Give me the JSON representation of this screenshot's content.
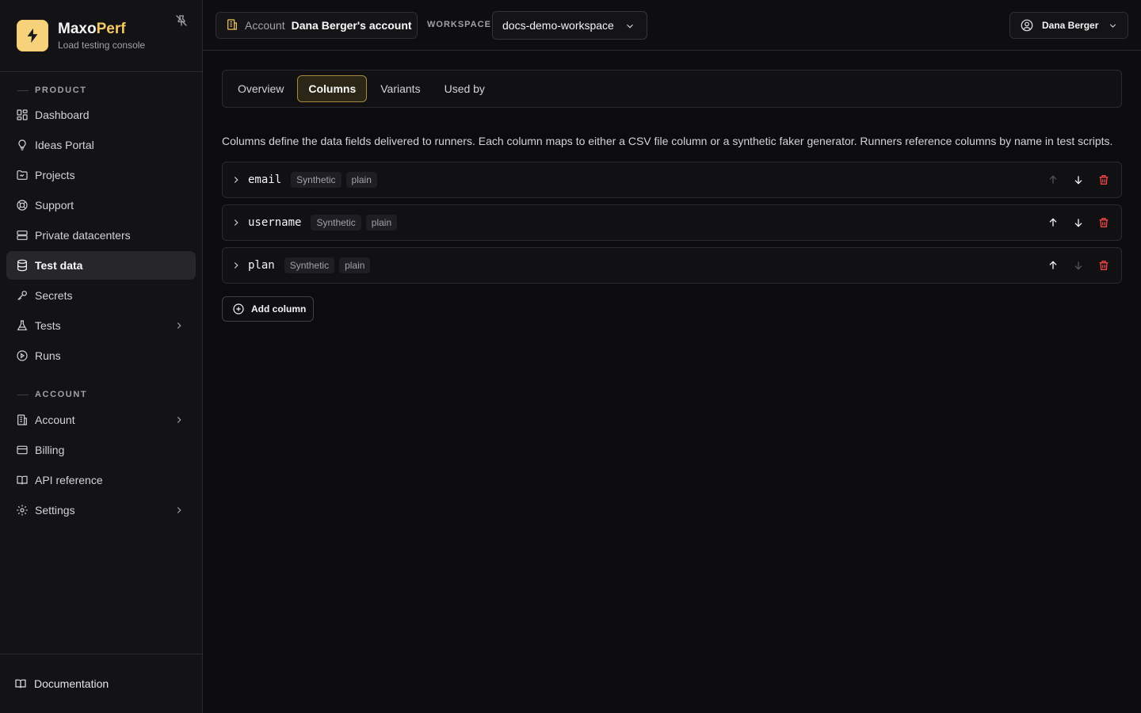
{
  "brand": {
    "name_prefix": "Maxo",
    "name_suffix": "Perf",
    "subtitle": "Load testing console",
    "accent": "#f6c863"
  },
  "sidebar": {
    "sections": [
      {
        "label": "PRODUCT"
      },
      {
        "label": "ACCOUNT"
      }
    ],
    "items": [
      {
        "label": "Dashboard",
        "icon": "dashboard-icon"
      },
      {
        "label": "Ideas Portal",
        "icon": "lightbulb-icon"
      },
      {
        "label": "Projects",
        "icon": "folder-icon"
      },
      {
        "label": "Support",
        "icon": "lifebuoy-icon"
      },
      {
        "label": "Private datacenters",
        "icon": "server-icon"
      },
      {
        "label": "Test data",
        "icon": "database-icon",
        "active": true
      },
      {
        "label": "Secrets",
        "icon": "key-icon"
      },
      {
        "label": "Tests",
        "icon": "flask-icon",
        "expandable": true
      },
      {
        "label": "Runs",
        "icon": "play-circle-icon"
      },
      {
        "label": "Account",
        "icon": "building-icon",
        "expandable": true
      },
      {
        "label": "Billing",
        "icon": "credit-card-icon"
      },
      {
        "label": "API reference",
        "icon": "book-icon"
      },
      {
        "label": "Settings",
        "icon": "gear-icon",
        "expandable": true
      }
    ],
    "footer": {
      "label": "Documentation",
      "icon": "book-icon"
    }
  },
  "topbar": {
    "account_label": "Account",
    "account_value": "Dana Berger's account",
    "workspace_label": "WORKSPACE",
    "workspace_value": "docs-demo-workspace",
    "user_name": "Dana Berger"
  },
  "tabs": [
    {
      "label": "Overview"
    },
    {
      "label": "Columns",
      "active": true
    },
    {
      "label": "Variants"
    },
    {
      "label": "Used by"
    }
  ],
  "description": "Columns define the data fields delivered to runners. Each column maps to either a CSV file column or a synthetic faker generator. Runners reference columns by name in test scripts.",
  "columns": [
    {
      "name": "email",
      "source": "Synthetic",
      "mode": "plain"
    },
    {
      "name": "username",
      "source": "Synthetic",
      "mode": "plain"
    },
    {
      "name": "plan",
      "source": "Synthetic",
      "mode": "plain"
    }
  ],
  "add_column_label": "Add column",
  "colors": {
    "delete": "#ef4444",
    "active_tab_border": "#a48a3f"
  }
}
